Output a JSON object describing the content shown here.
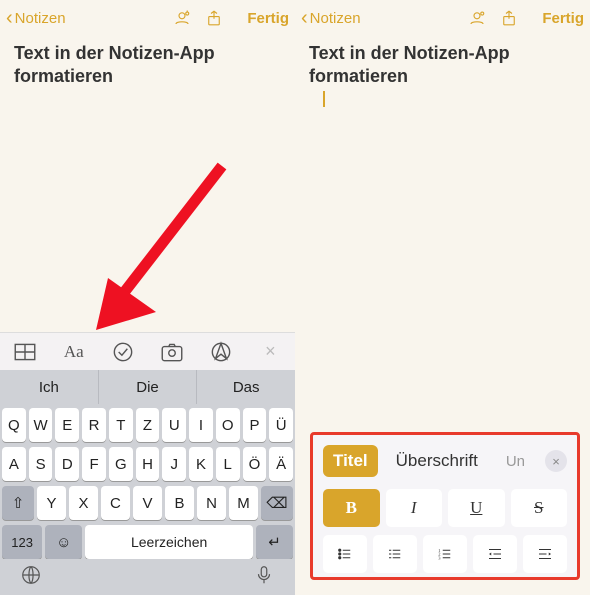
{
  "accent": "#d9a52b",
  "left": {
    "back_label": "Notizen",
    "done_label": "Fertig",
    "note_title": "Text in der Notizen-App formatieren",
    "toolbar": {
      "table": "table-icon",
      "text": "Aa",
      "check": "checkmark-icon",
      "camera": "camera-icon",
      "markup": "markup-icon",
      "close": "×"
    },
    "predictions": [
      "Ich",
      "Die",
      "Das"
    ],
    "keys_row1": [
      "Q",
      "W",
      "E",
      "R",
      "T",
      "Z",
      "U",
      "I",
      "O",
      "P",
      "Ü"
    ],
    "keys_row2": [
      "A",
      "S",
      "D",
      "F",
      "G",
      "H",
      "J",
      "K",
      "L",
      "Ö",
      "Ä"
    ],
    "keys_row3_shift": "⇧",
    "keys_row3": [
      "Y",
      "X",
      "C",
      "V",
      "B",
      "N",
      "M"
    ],
    "keys_row3_bksp": "⌫",
    "key_123": "123",
    "key_emoji": "☺",
    "key_space": "Leerzeichen",
    "key_return": "↵",
    "globe": "globe-icon",
    "mic": "mic-icon"
  },
  "right": {
    "back_label": "Notizen",
    "done_label": "Fertig",
    "note_title": "Text in der Notizen-App formatieren",
    "format": {
      "tab_title": "Titel",
      "tab_heading": "Überschrift",
      "tab_sub_truncated": "Un",
      "close": "×",
      "bold": "B",
      "italic": "I",
      "underline": "U",
      "strike": "S"
    }
  }
}
